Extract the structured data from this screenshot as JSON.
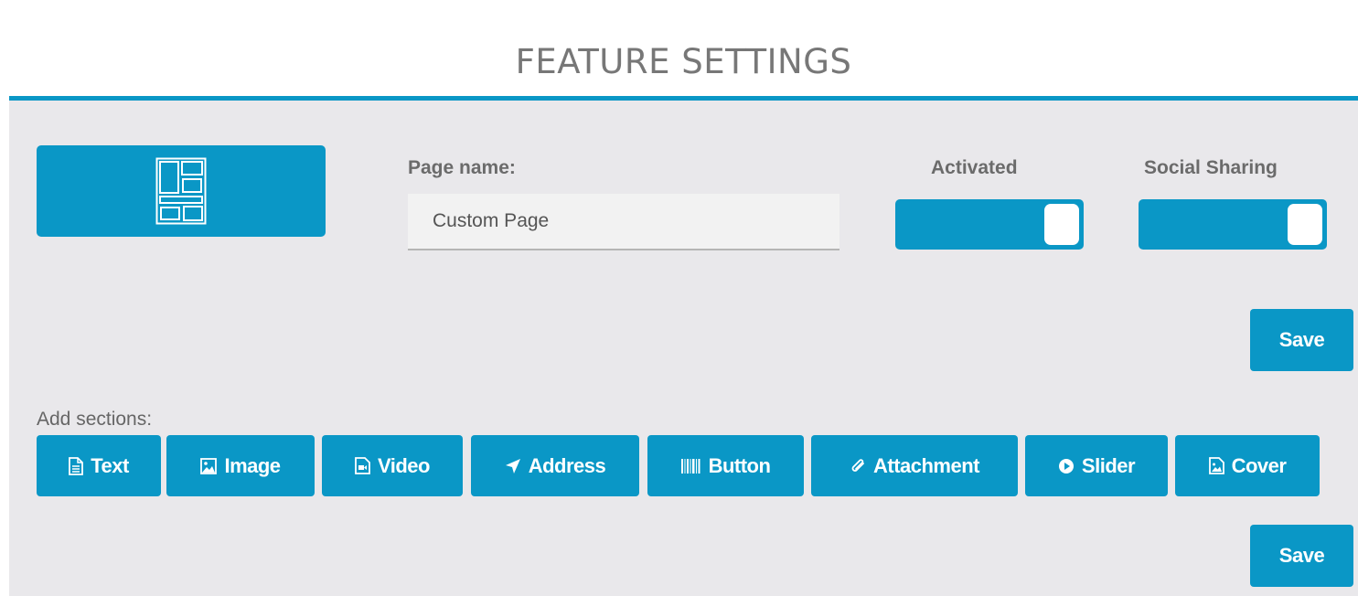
{
  "header": {
    "title": "FEATURE SETTINGS"
  },
  "form": {
    "page_name_label": "Page name:",
    "page_name_value": "Custom Page",
    "activated_label": "Activated",
    "activated_on": true,
    "social_label": "Social Sharing",
    "social_on": true,
    "save_label": "Save"
  },
  "sections": {
    "label": "Add sections:",
    "buttons": [
      {
        "label": "Text",
        "icon": "document-icon"
      },
      {
        "label": "Image",
        "icon": "image-icon"
      },
      {
        "label": "Video",
        "icon": "video-file-icon"
      },
      {
        "label": "Address",
        "icon": "location-arrow-icon"
      },
      {
        "label": "Button",
        "icon": "barcode-icon"
      },
      {
        "label": "Attachment",
        "icon": "paperclip-icon"
      },
      {
        "label": "Slider",
        "icon": "play-circle-icon"
      },
      {
        "label": "Cover",
        "icon": "image-file-icon"
      }
    ],
    "save_label": "Save"
  },
  "colors": {
    "accent": "#0a97c6",
    "panel_bg": "#e9e8eb",
    "title_text": "#777777",
    "label_text": "#6b6b6b"
  }
}
